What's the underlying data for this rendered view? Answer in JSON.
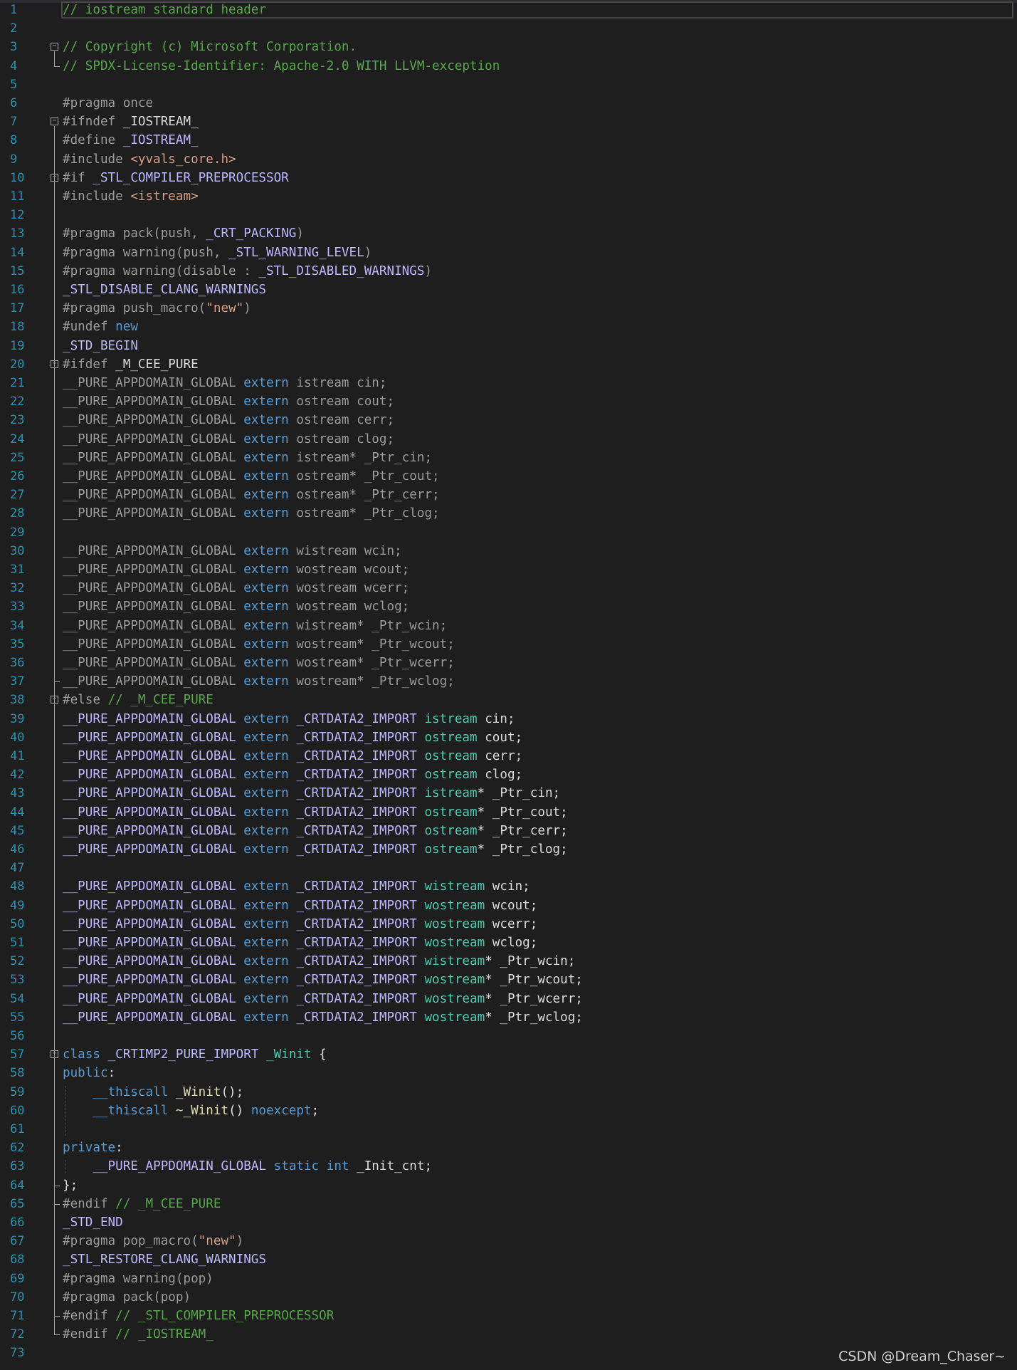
{
  "colors": {
    "background": "#1e1e1e",
    "line_number": "#2b91af",
    "comment": "#57a64a",
    "keyword": "#569cd6",
    "preprocessor": "#9b9b9b",
    "macro": "#bd63c5",
    "string": "#d69d85",
    "type": "#4ec9b0",
    "function": "#dcdcaa",
    "plain": "#dcdcdc"
  },
  "watermark": "CSDN @Dream_Chaser~",
  "lines": [
    {
      "n": "1",
      "tokens": [
        {
          "t": "// iostream standard header",
          "c": "comment"
        }
      ]
    },
    {
      "n": "2",
      "tokens": []
    },
    {
      "n": "3",
      "tokens": [
        {
          "t": "// Copyright (c) Microsoft Corporation.",
          "c": "comment"
        }
      ]
    },
    {
      "n": "4",
      "tokens": [
        {
          "t": "// SPDX-License-Identifier: Apache-2.0 WITH LLVM-exception",
          "c": "comment"
        }
      ]
    },
    {
      "n": "5",
      "tokens": []
    },
    {
      "n": "6",
      "tokens": [
        {
          "t": "#pragma once",
          "c": "pp"
        }
      ]
    },
    {
      "n": "7",
      "tokens": [
        {
          "t": "#ifndef ",
          "c": "pp"
        },
        {
          "t": "_IOSTREAM_",
          "c": "plain"
        }
      ]
    },
    {
      "n": "8",
      "tokens": [
        {
          "t": "#define ",
          "c": "pp"
        },
        {
          "t": "_IOSTREAM_",
          "c": "macro2"
        }
      ]
    },
    {
      "n": "9",
      "tokens": [
        {
          "t": "#include ",
          "c": "pp"
        },
        {
          "t": "<yvals_core.h>",
          "c": "str"
        }
      ]
    },
    {
      "n": "10",
      "tokens": [
        {
          "t": "#if ",
          "c": "pp"
        },
        {
          "t": "_STL_COMPILER_PREPROCESSOR",
          "c": "macro2"
        }
      ]
    },
    {
      "n": "11",
      "tokens": [
        {
          "t": "#include ",
          "c": "pp"
        },
        {
          "t": "<istream>",
          "c": "str"
        }
      ]
    },
    {
      "n": "12",
      "tokens": []
    },
    {
      "n": "13",
      "tokens": [
        {
          "t": "#pragma pack(push, ",
          "c": "pp"
        },
        {
          "t": "_CRT_PACKING",
          "c": "macro2"
        },
        {
          "t": ")",
          "c": "pp"
        }
      ]
    },
    {
      "n": "14",
      "tokens": [
        {
          "t": "#pragma warning(push, ",
          "c": "pp"
        },
        {
          "t": "_STL_WARNING_LEVEL",
          "c": "macro2"
        },
        {
          "t": ")",
          "c": "pp"
        }
      ]
    },
    {
      "n": "15",
      "tokens": [
        {
          "t": "#pragma warning(disable : ",
          "c": "pp"
        },
        {
          "t": "_STL_DISABLED_WARNINGS",
          "c": "macro2"
        },
        {
          "t": ")",
          "c": "pp"
        }
      ]
    },
    {
      "n": "16",
      "tokens": [
        {
          "t": "_STL_DISABLE_CLANG_WARNINGS",
          "c": "macro2"
        }
      ]
    },
    {
      "n": "17",
      "tokens": [
        {
          "t": "#pragma push_macro(",
          "c": "pp"
        },
        {
          "t": "\"new\"",
          "c": "str"
        },
        {
          "t": ")",
          "c": "pp"
        }
      ]
    },
    {
      "n": "18",
      "tokens": [
        {
          "t": "#undef ",
          "c": "pp"
        },
        {
          "t": "new",
          "c": "kw"
        }
      ]
    },
    {
      "n": "19",
      "tokens": [
        {
          "t": "_STD_BEGIN",
          "c": "macro2"
        }
      ]
    },
    {
      "n": "20",
      "tokens": [
        {
          "t": "#ifdef ",
          "c": "pp"
        },
        {
          "t": "_M_CEE_PURE",
          "c": "plain"
        }
      ]
    },
    {
      "n": "21",
      "tokens": [
        {
          "t": "__PURE_APPDOMAIN_GLOBAL ",
          "c": "dim"
        },
        {
          "t": "extern ",
          "c": "kw"
        },
        {
          "t": "istream cin;",
          "c": "dim"
        }
      ]
    },
    {
      "n": "22",
      "tokens": [
        {
          "t": "__PURE_APPDOMAIN_GLOBAL ",
          "c": "dim"
        },
        {
          "t": "extern ",
          "c": "kw"
        },
        {
          "t": "ostream cout;",
          "c": "dim"
        }
      ]
    },
    {
      "n": "23",
      "tokens": [
        {
          "t": "__PURE_APPDOMAIN_GLOBAL ",
          "c": "dim"
        },
        {
          "t": "extern ",
          "c": "kw"
        },
        {
          "t": "ostream cerr;",
          "c": "dim"
        }
      ]
    },
    {
      "n": "24",
      "tokens": [
        {
          "t": "__PURE_APPDOMAIN_GLOBAL ",
          "c": "dim"
        },
        {
          "t": "extern ",
          "c": "kw"
        },
        {
          "t": "ostream clog;",
          "c": "dim"
        }
      ]
    },
    {
      "n": "25",
      "tokens": [
        {
          "t": "__PURE_APPDOMAIN_GLOBAL ",
          "c": "dim"
        },
        {
          "t": "extern ",
          "c": "kw"
        },
        {
          "t": "istream* _Ptr_cin;",
          "c": "dim"
        }
      ]
    },
    {
      "n": "26",
      "tokens": [
        {
          "t": "__PURE_APPDOMAIN_GLOBAL ",
          "c": "dim"
        },
        {
          "t": "extern ",
          "c": "kw"
        },
        {
          "t": "ostream* _Ptr_cout;",
          "c": "dim"
        }
      ]
    },
    {
      "n": "27",
      "tokens": [
        {
          "t": "__PURE_APPDOMAIN_GLOBAL ",
          "c": "dim"
        },
        {
          "t": "extern ",
          "c": "kw"
        },
        {
          "t": "ostream* _Ptr_cerr;",
          "c": "dim"
        }
      ]
    },
    {
      "n": "28",
      "tokens": [
        {
          "t": "__PURE_APPDOMAIN_GLOBAL ",
          "c": "dim"
        },
        {
          "t": "extern ",
          "c": "kw"
        },
        {
          "t": "ostream* _Ptr_clog;",
          "c": "dim"
        }
      ]
    },
    {
      "n": "29",
      "tokens": []
    },
    {
      "n": "30",
      "tokens": [
        {
          "t": "__PURE_APPDOMAIN_GLOBAL ",
          "c": "dim"
        },
        {
          "t": "extern ",
          "c": "kw"
        },
        {
          "t": "wistream wcin;",
          "c": "dim"
        }
      ]
    },
    {
      "n": "31",
      "tokens": [
        {
          "t": "__PURE_APPDOMAIN_GLOBAL ",
          "c": "dim"
        },
        {
          "t": "extern ",
          "c": "kw"
        },
        {
          "t": "wostream wcout;",
          "c": "dim"
        }
      ]
    },
    {
      "n": "32",
      "tokens": [
        {
          "t": "__PURE_APPDOMAIN_GLOBAL ",
          "c": "dim"
        },
        {
          "t": "extern ",
          "c": "kw"
        },
        {
          "t": "wostream wcerr;",
          "c": "dim"
        }
      ]
    },
    {
      "n": "33",
      "tokens": [
        {
          "t": "__PURE_APPDOMAIN_GLOBAL ",
          "c": "dim"
        },
        {
          "t": "extern ",
          "c": "kw"
        },
        {
          "t": "wostream wclog;",
          "c": "dim"
        }
      ]
    },
    {
      "n": "34",
      "tokens": [
        {
          "t": "__PURE_APPDOMAIN_GLOBAL ",
          "c": "dim"
        },
        {
          "t": "extern ",
          "c": "kw"
        },
        {
          "t": "wistream* _Ptr_wcin;",
          "c": "dim"
        }
      ]
    },
    {
      "n": "35",
      "tokens": [
        {
          "t": "__PURE_APPDOMAIN_GLOBAL ",
          "c": "dim"
        },
        {
          "t": "extern ",
          "c": "kw"
        },
        {
          "t": "wostream* _Ptr_wcout;",
          "c": "dim"
        }
      ]
    },
    {
      "n": "36",
      "tokens": [
        {
          "t": "__PURE_APPDOMAIN_GLOBAL ",
          "c": "dim"
        },
        {
          "t": "extern ",
          "c": "kw"
        },
        {
          "t": "wostream* _Ptr_wcerr;",
          "c": "dim"
        }
      ]
    },
    {
      "n": "37",
      "tokens": [
        {
          "t": "__PURE_APPDOMAIN_GLOBAL ",
          "c": "dim"
        },
        {
          "t": "extern ",
          "c": "kw"
        },
        {
          "t": "wostream* _Ptr_wclog;",
          "c": "dim"
        }
      ]
    },
    {
      "n": "38",
      "tokens": [
        {
          "t": "#else ",
          "c": "pp"
        },
        {
          "t": "// _M_CEE_PURE",
          "c": "comment"
        }
      ]
    },
    {
      "n": "39",
      "tokens": [
        {
          "t": "__PURE_APPDOMAIN_GLOBAL ",
          "c": "macro2"
        },
        {
          "t": "extern ",
          "c": "kw"
        },
        {
          "t": "_CRTDATA2_IMPORT ",
          "c": "macro2"
        },
        {
          "t": "istream",
          "c": "type"
        },
        {
          "t": " cin;",
          "c": "plain"
        }
      ]
    },
    {
      "n": "40",
      "tokens": [
        {
          "t": "__PURE_APPDOMAIN_GLOBAL ",
          "c": "macro2"
        },
        {
          "t": "extern ",
          "c": "kw"
        },
        {
          "t": "_CRTDATA2_IMPORT ",
          "c": "macro2"
        },
        {
          "t": "ostream",
          "c": "type"
        },
        {
          "t": " cout;",
          "c": "plain"
        }
      ]
    },
    {
      "n": "41",
      "tokens": [
        {
          "t": "__PURE_APPDOMAIN_GLOBAL ",
          "c": "macro2"
        },
        {
          "t": "extern ",
          "c": "kw"
        },
        {
          "t": "_CRTDATA2_IMPORT ",
          "c": "macro2"
        },
        {
          "t": "ostream",
          "c": "type"
        },
        {
          "t": " cerr;",
          "c": "plain"
        }
      ]
    },
    {
      "n": "42",
      "tokens": [
        {
          "t": "__PURE_APPDOMAIN_GLOBAL ",
          "c": "macro2"
        },
        {
          "t": "extern ",
          "c": "kw"
        },
        {
          "t": "_CRTDATA2_IMPORT ",
          "c": "macro2"
        },
        {
          "t": "ostream",
          "c": "type"
        },
        {
          "t": " clog;",
          "c": "plain"
        }
      ]
    },
    {
      "n": "43",
      "tokens": [
        {
          "t": "__PURE_APPDOMAIN_GLOBAL ",
          "c": "macro2"
        },
        {
          "t": "extern ",
          "c": "kw"
        },
        {
          "t": "_CRTDATA2_IMPORT ",
          "c": "macro2"
        },
        {
          "t": "istream",
          "c": "type"
        },
        {
          "t": "* _Ptr_cin;",
          "c": "plain"
        }
      ]
    },
    {
      "n": "44",
      "tokens": [
        {
          "t": "__PURE_APPDOMAIN_GLOBAL ",
          "c": "macro2"
        },
        {
          "t": "extern ",
          "c": "kw"
        },
        {
          "t": "_CRTDATA2_IMPORT ",
          "c": "macro2"
        },
        {
          "t": "ostream",
          "c": "type"
        },
        {
          "t": "* _Ptr_cout;",
          "c": "plain"
        }
      ]
    },
    {
      "n": "45",
      "tokens": [
        {
          "t": "__PURE_APPDOMAIN_GLOBAL ",
          "c": "macro2"
        },
        {
          "t": "extern ",
          "c": "kw"
        },
        {
          "t": "_CRTDATA2_IMPORT ",
          "c": "macro2"
        },
        {
          "t": "ostream",
          "c": "type"
        },
        {
          "t": "* _Ptr_cerr;",
          "c": "plain"
        }
      ]
    },
    {
      "n": "46",
      "tokens": [
        {
          "t": "__PURE_APPDOMAIN_GLOBAL ",
          "c": "macro2"
        },
        {
          "t": "extern ",
          "c": "kw"
        },
        {
          "t": "_CRTDATA2_IMPORT ",
          "c": "macro2"
        },
        {
          "t": "ostream",
          "c": "type"
        },
        {
          "t": "* _Ptr_clog;",
          "c": "plain"
        }
      ]
    },
    {
      "n": "47",
      "tokens": []
    },
    {
      "n": "48",
      "tokens": [
        {
          "t": "__PURE_APPDOMAIN_GLOBAL ",
          "c": "macro2"
        },
        {
          "t": "extern ",
          "c": "kw"
        },
        {
          "t": "_CRTDATA2_IMPORT ",
          "c": "macro2"
        },
        {
          "t": "wistream",
          "c": "type"
        },
        {
          "t": " wcin;",
          "c": "plain"
        }
      ]
    },
    {
      "n": "49",
      "tokens": [
        {
          "t": "__PURE_APPDOMAIN_GLOBAL ",
          "c": "macro2"
        },
        {
          "t": "extern ",
          "c": "kw"
        },
        {
          "t": "_CRTDATA2_IMPORT ",
          "c": "macro2"
        },
        {
          "t": "wostream",
          "c": "type"
        },
        {
          "t": " wcout;",
          "c": "plain"
        }
      ]
    },
    {
      "n": "50",
      "tokens": [
        {
          "t": "__PURE_APPDOMAIN_GLOBAL ",
          "c": "macro2"
        },
        {
          "t": "extern ",
          "c": "kw"
        },
        {
          "t": "_CRTDATA2_IMPORT ",
          "c": "macro2"
        },
        {
          "t": "wostream",
          "c": "type"
        },
        {
          "t": " wcerr;",
          "c": "plain"
        }
      ]
    },
    {
      "n": "51",
      "tokens": [
        {
          "t": "__PURE_APPDOMAIN_GLOBAL ",
          "c": "macro2"
        },
        {
          "t": "extern ",
          "c": "kw"
        },
        {
          "t": "_CRTDATA2_IMPORT ",
          "c": "macro2"
        },
        {
          "t": "wostream",
          "c": "type"
        },
        {
          "t": " wclog;",
          "c": "plain"
        }
      ]
    },
    {
      "n": "52",
      "tokens": [
        {
          "t": "__PURE_APPDOMAIN_GLOBAL ",
          "c": "macro2"
        },
        {
          "t": "extern ",
          "c": "kw"
        },
        {
          "t": "_CRTDATA2_IMPORT ",
          "c": "macro2"
        },
        {
          "t": "wistream",
          "c": "type"
        },
        {
          "t": "* _Ptr_wcin;",
          "c": "plain"
        }
      ]
    },
    {
      "n": "53",
      "tokens": [
        {
          "t": "__PURE_APPDOMAIN_GLOBAL ",
          "c": "macro2"
        },
        {
          "t": "extern ",
          "c": "kw"
        },
        {
          "t": "_CRTDATA2_IMPORT ",
          "c": "macro2"
        },
        {
          "t": "wostream",
          "c": "type"
        },
        {
          "t": "* _Ptr_wcout;",
          "c": "plain"
        }
      ]
    },
    {
      "n": "54",
      "tokens": [
        {
          "t": "__PURE_APPDOMAIN_GLOBAL ",
          "c": "macro2"
        },
        {
          "t": "extern ",
          "c": "kw"
        },
        {
          "t": "_CRTDATA2_IMPORT ",
          "c": "macro2"
        },
        {
          "t": "wostream",
          "c": "type"
        },
        {
          "t": "* _Ptr_wcerr;",
          "c": "plain"
        }
      ]
    },
    {
      "n": "55",
      "tokens": [
        {
          "t": "__PURE_APPDOMAIN_GLOBAL ",
          "c": "macro2"
        },
        {
          "t": "extern ",
          "c": "kw"
        },
        {
          "t": "_CRTDATA2_IMPORT ",
          "c": "macro2"
        },
        {
          "t": "wostream",
          "c": "type"
        },
        {
          "t": "* _Ptr_wclog;",
          "c": "plain"
        }
      ]
    },
    {
      "n": "56",
      "tokens": []
    },
    {
      "n": "57",
      "tokens": [
        {
          "t": "class ",
          "c": "kw"
        },
        {
          "t": "_CRTIMP2_PURE_IMPORT ",
          "c": "macro2"
        },
        {
          "t": "_Winit",
          "c": "type"
        },
        {
          "t": " {",
          "c": "plain"
        }
      ]
    },
    {
      "n": "58",
      "tokens": [
        {
          "t": "public",
          "c": "kw"
        },
        {
          "t": ":",
          "c": "plain"
        }
      ]
    },
    {
      "n": "59",
      "tokens": [
        {
          "t": "    ",
          "c": "plain"
        },
        {
          "t": "__thiscall ",
          "c": "kw"
        },
        {
          "t": "_Winit",
          "c": "func"
        },
        {
          "t": "();",
          "c": "plain"
        }
      ]
    },
    {
      "n": "60",
      "tokens": [
        {
          "t": "    ",
          "c": "plain"
        },
        {
          "t": "__thiscall ",
          "c": "kw"
        },
        {
          "t": "~_Winit",
          "c": "func"
        },
        {
          "t": "() ",
          "c": "plain"
        },
        {
          "t": "noexcept",
          "c": "kw"
        },
        {
          "t": ";",
          "c": "plain"
        }
      ]
    },
    {
      "n": "61",
      "tokens": []
    },
    {
      "n": "62",
      "tokens": [
        {
          "t": "private",
          "c": "kw"
        },
        {
          "t": ":",
          "c": "plain"
        }
      ]
    },
    {
      "n": "63",
      "tokens": [
        {
          "t": "    ",
          "c": "plain"
        },
        {
          "t": "__PURE_APPDOMAIN_GLOBAL ",
          "c": "macro2"
        },
        {
          "t": "static ",
          "c": "kw"
        },
        {
          "t": "int ",
          "c": "kw"
        },
        {
          "t": "_Init_cnt;",
          "c": "plain"
        }
      ]
    },
    {
      "n": "64",
      "tokens": [
        {
          "t": "};",
          "c": "plain"
        }
      ]
    },
    {
      "n": "65",
      "tokens": [
        {
          "t": "#endif ",
          "c": "pp"
        },
        {
          "t": "// _M_CEE_PURE",
          "c": "comment"
        }
      ]
    },
    {
      "n": "66",
      "tokens": [
        {
          "t": "_STD_END",
          "c": "macro2"
        }
      ]
    },
    {
      "n": "67",
      "tokens": [
        {
          "t": "#pragma pop_macro(",
          "c": "pp"
        },
        {
          "t": "\"new\"",
          "c": "str"
        },
        {
          "t": ")",
          "c": "pp"
        }
      ]
    },
    {
      "n": "68",
      "tokens": [
        {
          "t": "_STL_RESTORE_CLANG_WARNINGS",
          "c": "macro2"
        }
      ]
    },
    {
      "n": "69",
      "tokens": [
        {
          "t": "#pragma warning(pop)",
          "c": "pp"
        }
      ]
    },
    {
      "n": "70",
      "tokens": [
        {
          "t": "#pragma pack(pop)",
          "c": "pp"
        }
      ]
    },
    {
      "n": "71",
      "tokens": [
        {
          "t": "#endif ",
          "c": "pp"
        },
        {
          "t": "// _STL_COMPILER_PREPROCESSOR",
          "c": "comment"
        }
      ]
    },
    {
      "n": "72",
      "tokens": [
        {
          "t": "#endif ",
          "c": "pp"
        },
        {
          "t": "// _IOSTREAM_",
          "c": "comment"
        }
      ]
    },
    {
      "n": "73",
      "tokens": []
    }
  ],
  "fold_markers": [
    "3",
    "7",
    "10",
    "20",
    "38",
    "57"
  ]
}
